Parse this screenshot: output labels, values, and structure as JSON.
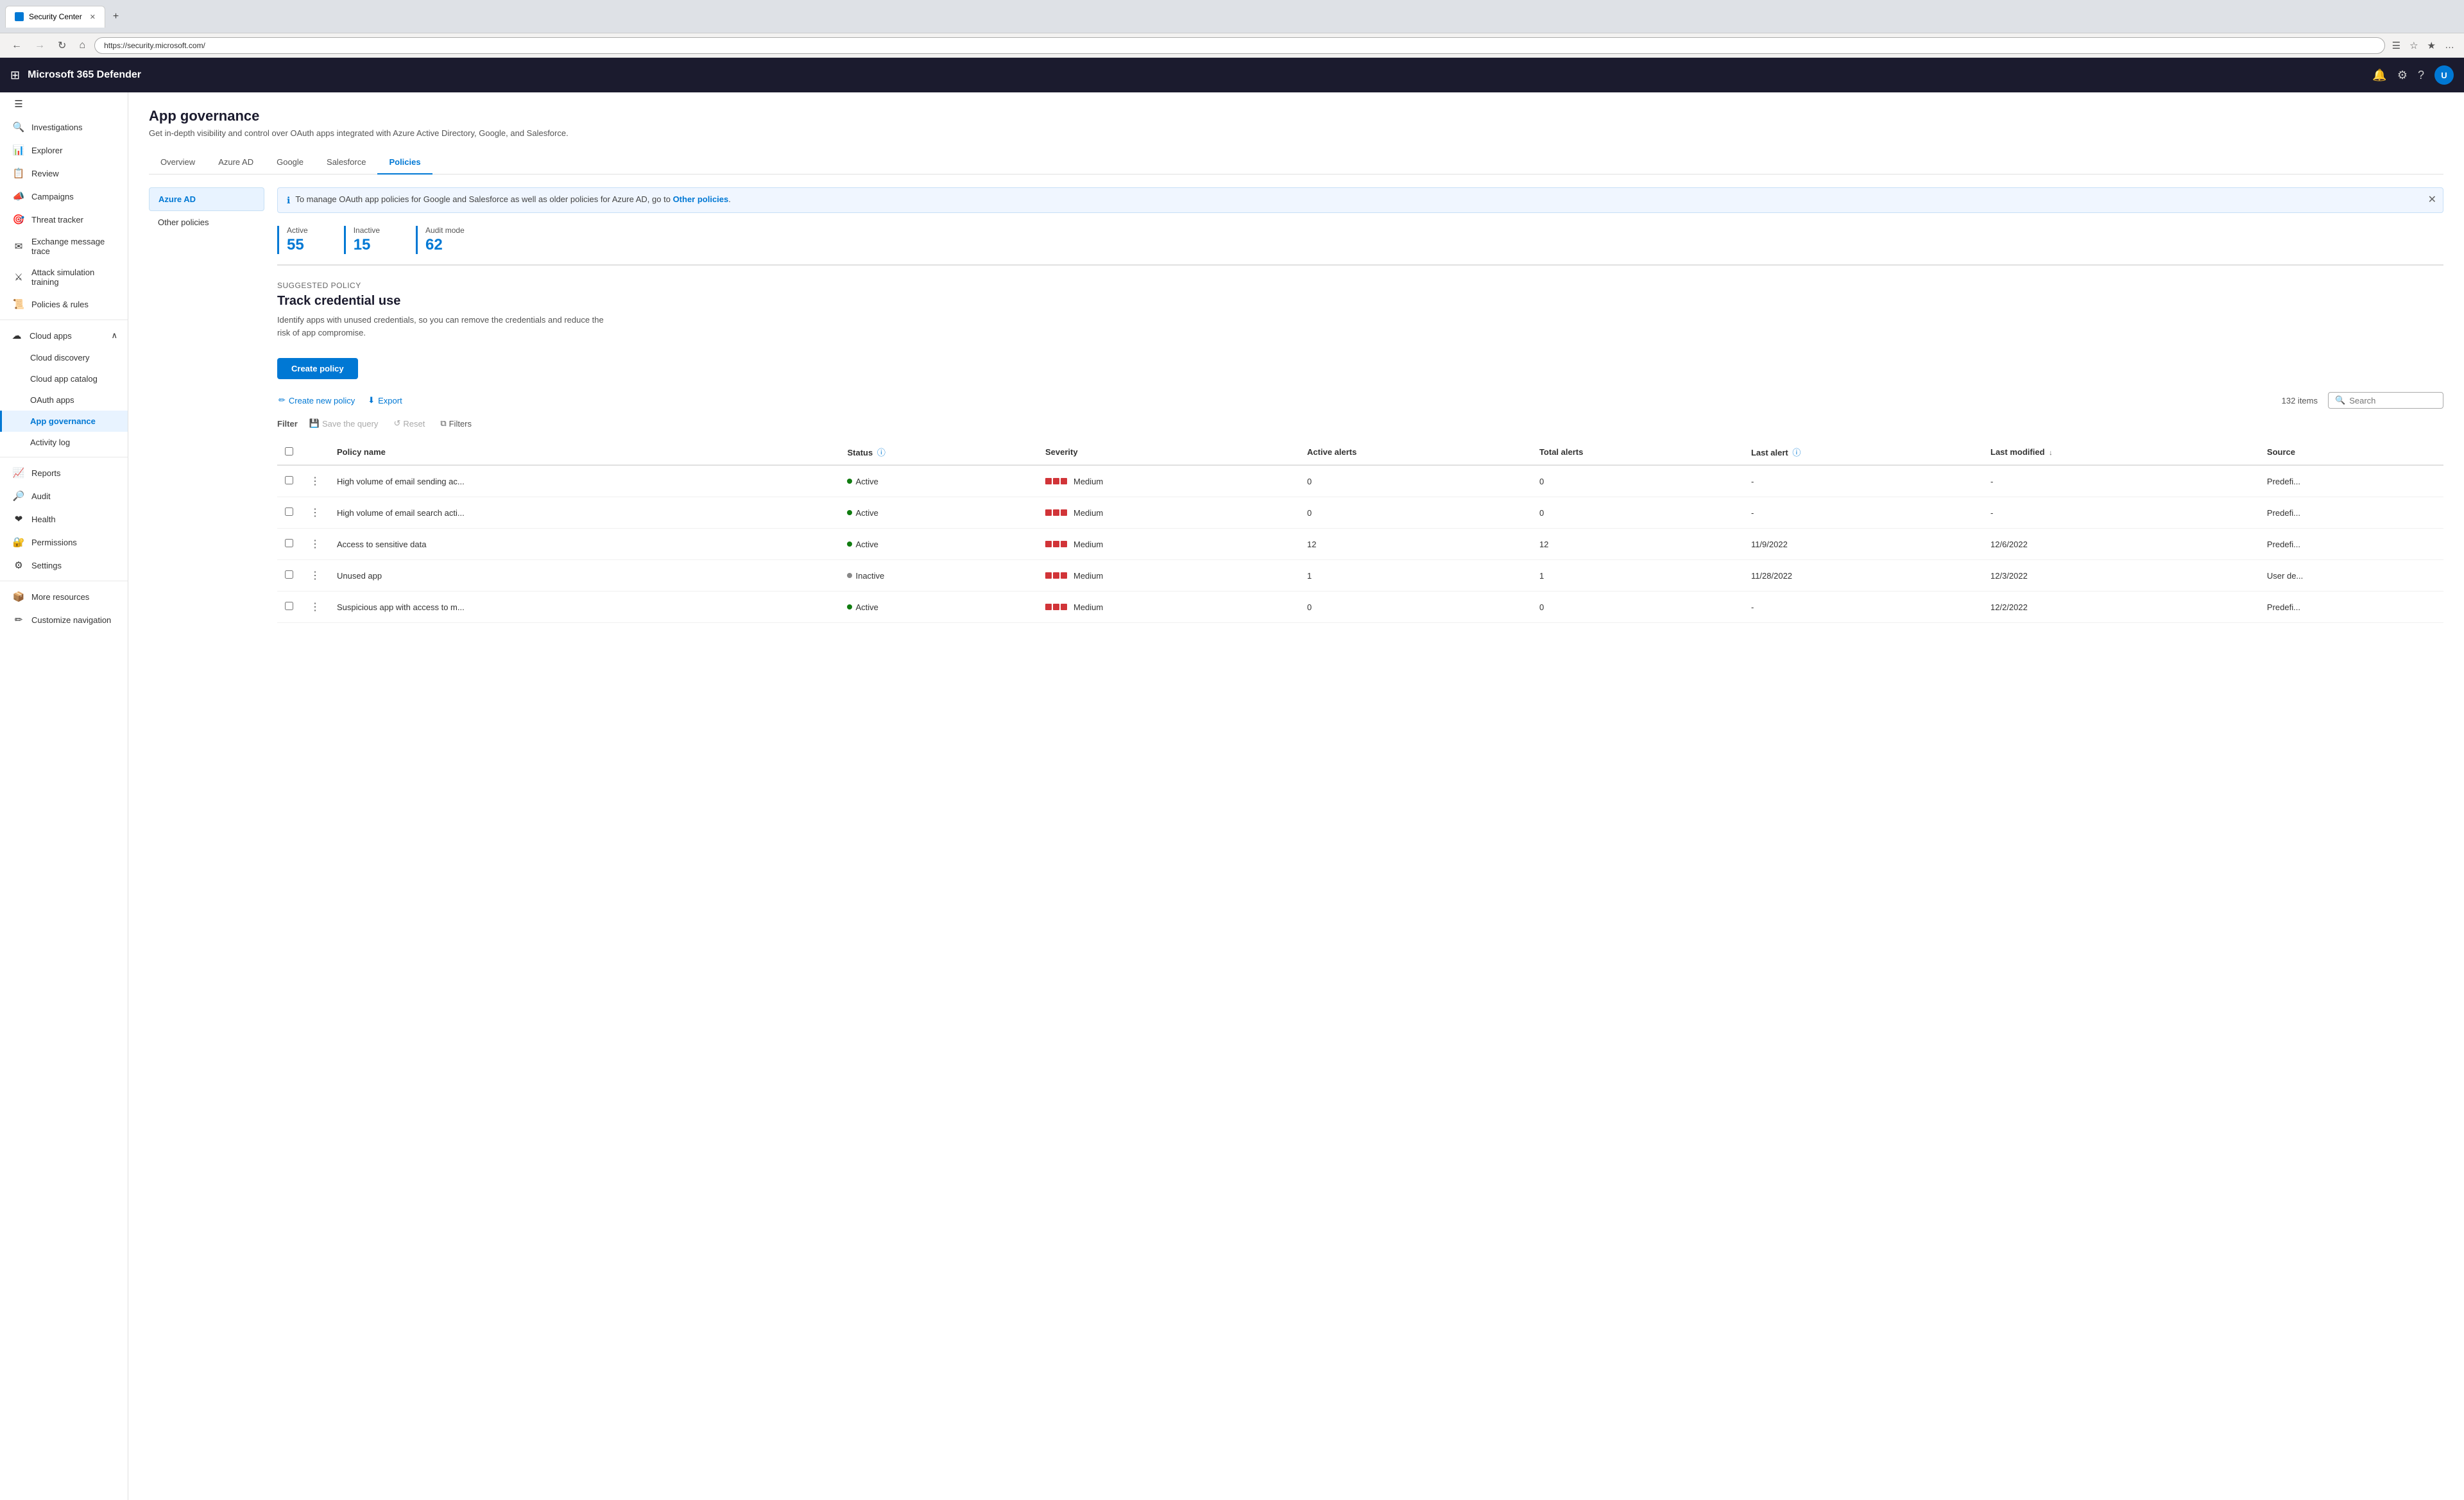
{
  "browser": {
    "tab_title": "Security Center",
    "tab_icon": "shield",
    "url": "https://security.microsoft.com/",
    "new_tab_label": "+",
    "nav_back": "←",
    "nav_forward": "→",
    "nav_refresh": "↻",
    "nav_home": "⌂"
  },
  "app": {
    "title": "Microsoft 365 Defender",
    "waffle_icon": "⊞",
    "bell_icon": "🔔",
    "settings_icon": "⚙",
    "help_icon": "?",
    "avatar_initials": "U"
  },
  "sidebar": {
    "collapse_icon": "☰",
    "items": [
      {
        "id": "investigations",
        "label": "Investigations",
        "icon": "🔍"
      },
      {
        "id": "explorer",
        "label": "Explorer",
        "icon": "📊"
      },
      {
        "id": "review",
        "label": "Review",
        "icon": "📋"
      },
      {
        "id": "campaigns",
        "label": "Campaigns",
        "icon": "📣"
      },
      {
        "id": "threat-tracker",
        "label": "Threat tracker",
        "icon": "🎯"
      },
      {
        "id": "exchange-message-trace",
        "label": "Exchange message trace",
        "icon": "✉"
      },
      {
        "id": "attack-simulation",
        "label": "Attack simulation training",
        "icon": "⚔"
      },
      {
        "id": "policies-rules",
        "label": "Policies & rules",
        "icon": "📜"
      }
    ],
    "cloud_apps_group": {
      "label": "Cloud apps",
      "expanded": true,
      "toggle_icon": "∧",
      "sub_items": [
        {
          "id": "cloud-discovery",
          "label": "Cloud discovery",
          "icon": "☁"
        },
        {
          "id": "cloud-app-catalog",
          "label": "Cloud app catalog",
          "icon": "📚"
        },
        {
          "id": "oauth-apps",
          "label": "OAuth apps",
          "icon": "🔑"
        },
        {
          "id": "app-governance",
          "label": "App governance",
          "icon": "🛡",
          "active": true
        },
        {
          "id": "activity-log",
          "label": "Activity log",
          "icon": "📝"
        }
      ]
    },
    "bottom_items": [
      {
        "id": "reports",
        "label": "Reports",
        "icon": "📈"
      },
      {
        "id": "audit",
        "label": "Audit",
        "icon": "🔎"
      },
      {
        "id": "health",
        "label": "Health",
        "icon": "❤"
      },
      {
        "id": "permissions",
        "label": "Permissions",
        "icon": "🔐"
      },
      {
        "id": "settings",
        "label": "Settings",
        "icon": "⚙"
      },
      {
        "id": "more-resources",
        "label": "More resources",
        "icon": "📦"
      },
      {
        "id": "customize-nav",
        "label": "Customize navigation",
        "icon": "✏"
      }
    ]
  },
  "page": {
    "title": "App governance",
    "subtitle": "Get in-depth visibility and control over OAuth apps integrated with Azure Active Directory, Google, and Salesforce.",
    "tabs": [
      {
        "id": "overview",
        "label": "Overview",
        "active": false
      },
      {
        "id": "azure-ad",
        "label": "Azure AD",
        "active": false
      },
      {
        "id": "google",
        "label": "Google",
        "active": false
      },
      {
        "id": "salesforce",
        "label": "Salesforce",
        "active": false
      },
      {
        "id": "policies",
        "label": "Policies",
        "active": true
      }
    ]
  },
  "policy_sidebar": {
    "items": [
      {
        "id": "azure-ad",
        "label": "Azure AD",
        "active": true
      },
      {
        "id": "other-policies",
        "label": "Other policies",
        "active": false
      }
    ]
  },
  "info_banner": {
    "text": "To manage OAuth app policies for Google and Salesforce as well as older policies for Azure AD, go to",
    "link_text": "Other policies",
    "link_suffix": ".",
    "close_icon": "✕"
  },
  "stats": [
    {
      "label": "Active",
      "value": "55"
    },
    {
      "label": "Inactive",
      "value": "15"
    },
    {
      "label": "Audit mode",
      "value": "62"
    }
  ],
  "suggested_policy": {
    "section_label": "Suggested policy",
    "title": "Track credential use",
    "description": "Identify apps with unused credentials, so you can remove the credentials and reduce the risk of app compromise."
  },
  "create_policy_btn": "Create policy",
  "toolbar": {
    "create_new_policy": "Create new policy",
    "export": "Export",
    "create_icon": "✏",
    "export_icon": "⬇",
    "items_count": "132 items"
  },
  "filter_row": {
    "filter_label": "Filter",
    "save_query": "Save the query",
    "reset": "Reset",
    "filters": "Filters",
    "save_icon": "💾",
    "reset_icon": "↺",
    "filter_icon": "⧉"
  },
  "search": {
    "placeholder": "Search",
    "icon": "🔍"
  },
  "table": {
    "columns": [
      {
        "id": "checkbox",
        "label": ""
      },
      {
        "id": "more",
        "label": ""
      },
      {
        "id": "policy-name",
        "label": "Policy name"
      },
      {
        "id": "status",
        "label": "Status",
        "has_info": true
      },
      {
        "id": "severity",
        "label": "Severity"
      },
      {
        "id": "active-alerts",
        "label": "Active alerts"
      },
      {
        "id": "total-alerts",
        "label": "Total alerts"
      },
      {
        "id": "last-alert",
        "label": "Last alert",
        "has_info": true
      },
      {
        "id": "last-modified",
        "label": "Last modified",
        "sorted": true,
        "sort_dir": "desc"
      },
      {
        "id": "source",
        "label": "Source"
      }
    ],
    "rows": [
      {
        "id": "row1",
        "policy_name": "High volume of email sending ac...",
        "status": "Active",
        "status_type": "active",
        "severity": "Medium",
        "severity_type": "medium",
        "active_alerts": "0",
        "total_alerts": "0",
        "last_alert": "-",
        "last_modified": "-",
        "source": "Predefi..."
      },
      {
        "id": "row2",
        "policy_name": "High volume of email search acti...",
        "status": "Active",
        "status_type": "active",
        "severity": "Medium",
        "severity_type": "medium",
        "active_alerts": "0",
        "total_alerts": "0",
        "last_alert": "-",
        "last_modified": "-",
        "source": "Predefi..."
      },
      {
        "id": "row3",
        "policy_name": "Access to sensitive data",
        "status": "Active",
        "status_type": "active",
        "severity": "Medium",
        "severity_type": "medium",
        "active_alerts": "12",
        "total_alerts": "12",
        "last_alert": "11/9/2022",
        "last_modified": "12/6/2022",
        "source": "Predefi..."
      },
      {
        "id": "row4",
        "policy_name": "Unused app",
        "status": "Inactive",
        "status_type": "inactive",
        "severity": "Medium",
        "severity_type": "medium",
        "active_alerts": "1",
        "total_alerts": "1",
        "last_alert": "11/28/2022",
        "last_modified": "12/3/2022",
        "source": "User de..."
      },
      {
        "id": "row5",
        "policy_name": "Suspicious app with access to m...",
        "status": "Active",
        "status_type": "active",
        "severity": "Medium",
        "severity_type": "medium",
        "active_alerts": "0",
        "total_alerts": "0",
        "last_alert": "-",
        "last_modified": "12/2/2022",
        "source": "Predefi..."
      }
    ]
  }
}
